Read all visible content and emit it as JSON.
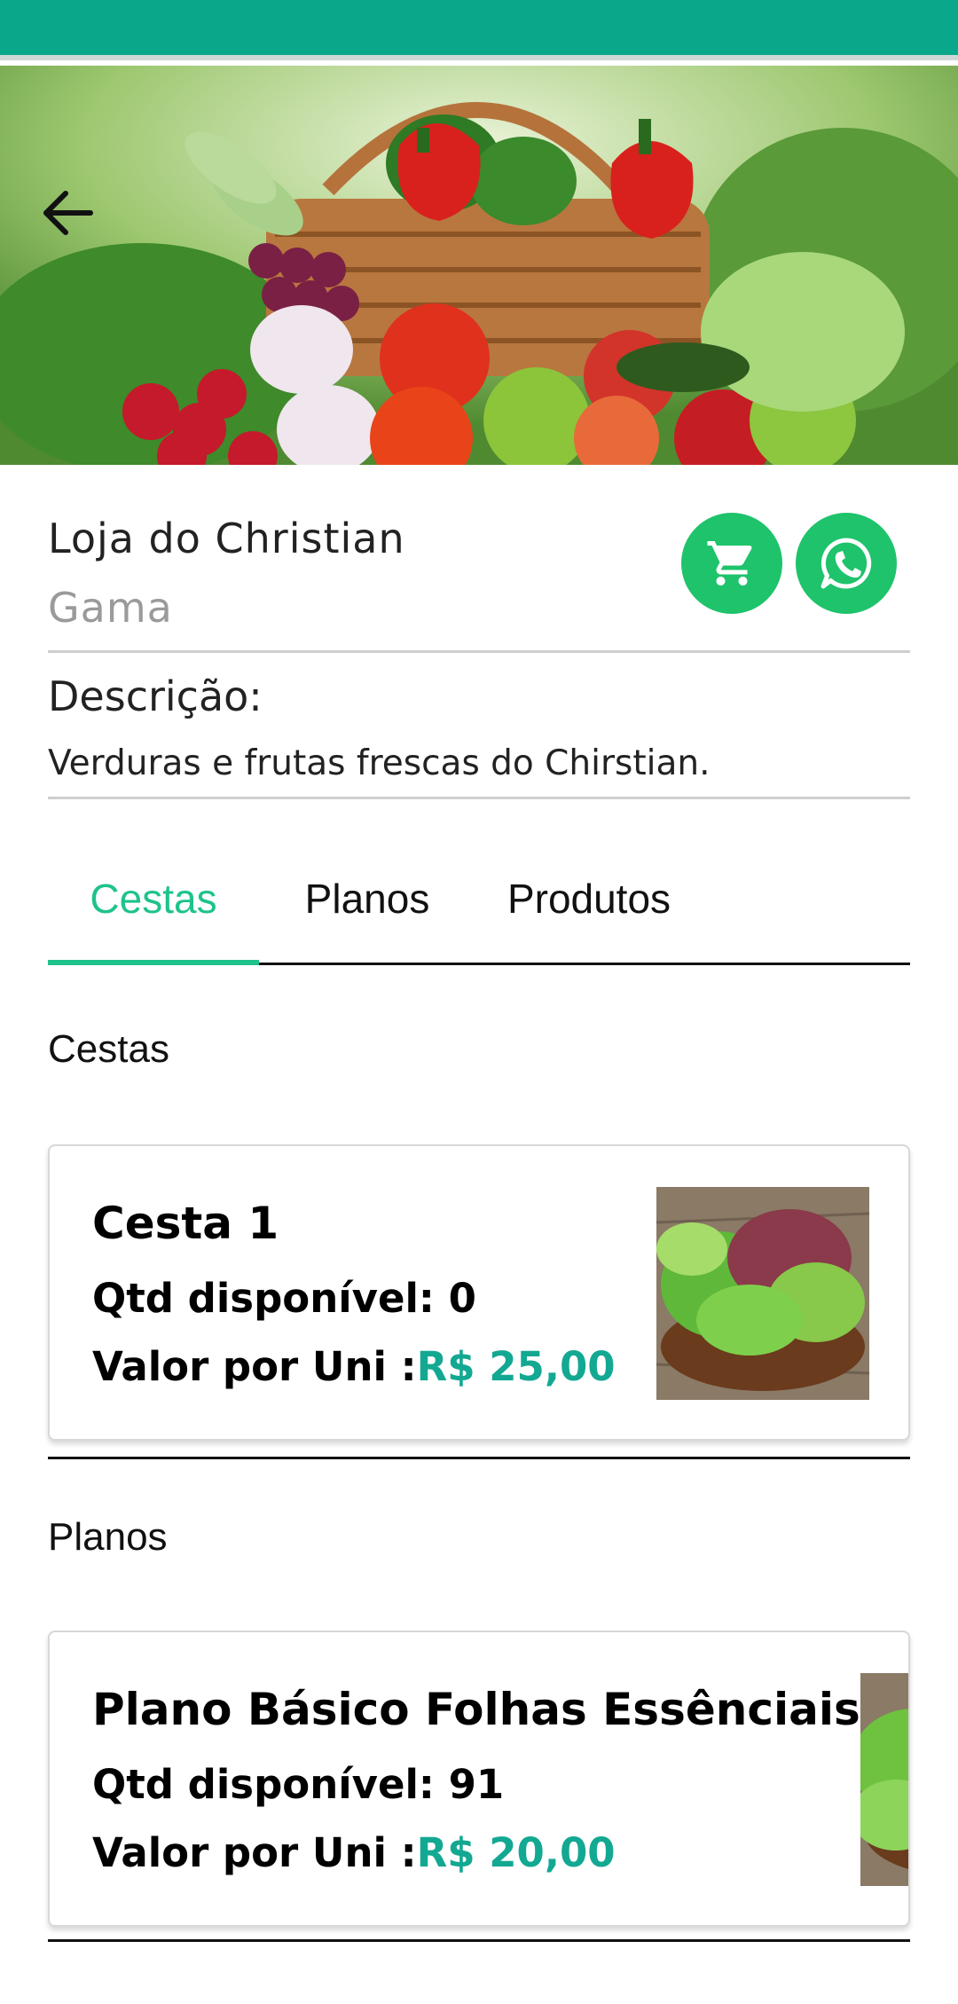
{
  "store": {
    "name": "Loja do Christian",
    "location": "Gama",
    "description_label": "Descrição:",
    "description": "Verduras e frutas frescas do Chirstian."
  },
  "icons": {
    "back": "arrow-left-icon",
    "cart": "shopping-cart-icon",
    "whatsapp": "whatsapp-icon"
  },
  "colors": {
    "status_bar": "#0aa88a",
    "accent": "#1ec38a",
    "button": "#1ec36b",
    "price": "#13a892"
  },
  "tabs": [
    {
      "label": "Cestas",
      "active": true
    },
    {
      "label": "Planos",
      "active": false
    },
    {
      "label": "Produtos",
      "active": false
    }
  ],
  "sections": [
    {
      "title": "Cestas",
      "items": [
        {
          "name": "Cesta 1",
          "qty_label": "Qtd disponível: 0",
          "price_label": "Valor por Uni :",
          "price": "R$ 25,00"
        }
      ]
    },
    {
      "title": "Planos",
      "items": [
        {
          "name": "Plano Básico Folhas Essênciais",
          "qty_label": "Qtd disponível: 91",
          "price_label": "Valor por Uni :",
          "price": "R$ 20,00"
        }
      ]
    }
  ]
}
